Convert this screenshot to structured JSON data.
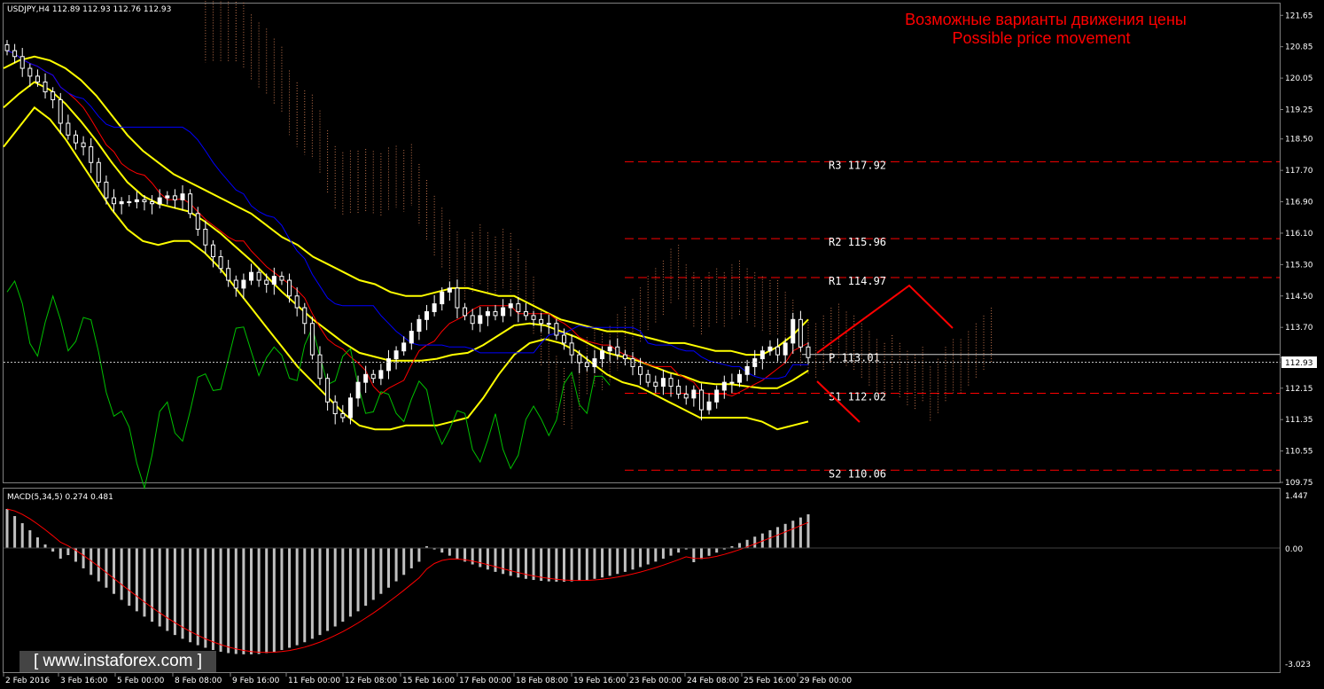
{
  "header": {
    "symbol_line": "USDJPY,H4  112.89 112.93 112.76 112.93",
    "macd_line": "MACD(5,34,5) 0.274 0.481"
  },
  "title_ru": "Возможные варианты движения цены",
  "title_en": "Possible price movement",
  "current_price_label": "112.93",
  "watermark": "[ www.instaforex.com ]",
  "colors": {
    "background": "#000000",
    "bull_candle": "#ffffff",
    "bear_candle": "#ffffff",
    "bollinger": "#ffff00",
    "tenkan": "#ff0000",
    "kijun": "#0000ff",
    "chikou": "#00c000",
    "cloud": "#ff9966",
    "pivot_levels": "#ff0000",
    "forecast": "#ff0000",
    "macd_hist": "#c0c0c0",
    "macd_signal": "#ff0000"
  },
  "chart_data": {
    "type": "candlestick",
    "symbol": "USDJPY",
    "timeframe": "H4",
    "ylim": [
      109.75,
      121.95
    ],
    "y_ticks": [
      "121.65",
      "120.85",
      "120.05",
      "119.25",
      "118.50",
      "117.70",
      "116.90",
      "116.10",
      "115.30",
      "114.50",
      "113.70",
      "112.93",
      "112.15",
      "111.35",
      "110.55",
      "109.75"
    ],
    "x_ticks": [
      "2 Feb 2016",
      "3 Feb 16:00",
      "5 Feb 00:00",
      "8 Feb 08:00",
      "9 Feb 16:00",
      "11 Feb 00:00",
      "12 Feb 08:00",
      "15 Feb 16:00",
      "17 Feb 00:00",
      "18 Feb 08:00",
      "19 Feb 16:00",
      "23 Feb 00:00",
      "24 Feb 08:00",
      "25 Feb 16:00",
      "29 Feb 00:00"
    ],
    "levels": [
      {
        "label": "R3 117.92",
        "value": 117.92
      },
      {
        "label": "R2 115.96",
        "value": 115.96
      },
      {
        "label": "R1 114.97",
        "value": 114.97
      },
      {
        "label": "P 113.01",
        "value": 113.01
      },
      {
        "label": "S1 112.02",
        "value": 112.02
      },
      {
        "label": "S2 110.06",
        "value": 110.06
      }
    ],
    "current_price": 112.93,
    "closes": [
      120.75,
      120.6,
      120.3,
      120.1,
      119.95,
      119.7,
      119.5,
      118.9,
      118.6,
      118.4,
      118.3,
      117.9,
      117.4,
      117.0,
      116.85,
      116.9,
      116.9,
      116.95,
      116.9,
      116.85,
      117.0,
      117.05,
      116.95,
      117.1,
      116.6,
      116.2,
      115.8,
      115.5,
      115.2,
      114.9,
      114.7,
      114.9,
      115.1,
      114.9,
      114.8,
      115.0,
      114.9,
      114.5,
      114.2,
      113.8,
      113.0,
      112.4,
      111.8,
      111.5,
      111.4,
      111.9,
      112.3,
      112.5,
      112.4,
      112.6,
      112.9,
      113.1,
      113.3,
      113.6,
      113.9,
      114.1,
      114.3,
      114.6,
      114.7,
      114.2,
      114.0,
      113.8,
      114.0,
      114.1,
      114.0,
      114.2,
      114.3,
      114.1,
      114.0,
      113.9,
      113.8,
      113.8,
      113.5,
      113.3,
      113.0,
      112.8,
      112.7,
      112.9,
      113.1,
      113.2,
      113.0,
      112.9,
      112.7,
      112.5,
      112.3,
      112.2,
      112.4,
      112.2,
      112.0,
      111.9,
      112.1,
      111.6,
      111.8,
      112.1,
      112.3,
      112.3,
      112.5,
      112.7,
      112.9,
      113.1,
      113.2,
      113.0,
      113.3,
      113.9,
      113.2,
      112.93
    ],
    "bollinger_upper": [
      120.3,
      120.5,
      120.6,
      120.5,
      120.3,
      120.0,
      119.6,
      119.1,
      118.6,
      118.2,
      117.9,
      117.6,
      117.4,
      117.2,
      117.0,
      116.8,
      116.6,
      116.3,
      116.0,
      115.8,
      115.5,
      115.3,
      115.1,
      114.9,
      114.8,
      114.6,
      114.5,
      114.5,
      114.6,
      114.7,
      114.7,
      114.6,
      114.5,
      114.5,
      114.3,
      114.1,
      113.9,
      113.8,
      113.7,
      113.6,
      113.6,
      113.5,
      113.4,
      113.3,
      113.3,
      113.2,
      113.1,
      113.1,
      113.0,
      113.0,
      113.2,
      113.5,
      113.9
    ],
    "bollinger_lower": [
      118.3,
      118.8,
      119.3,
      119.0,
      118.5,
      117.9,
      117.3,
      116.7,
      116.2,
      115.9,
      115.8,
      115.9,
      115.9,
      115.6,
      115.2,
      114.7,
      114.2,
      113.7,
      113.2,
      112.7,
      112.3,
      111.9,
      111.5,
      111.2,
      111.1,
      111.1,
      111.2,
      111.2,
      111.2,
      111.3,
      111.4,
      111.9,
      112.5,
      113.0,
      113.3,
      113.4,
      113.3,
      113.1,
      112.8,
      112.5,
      112.3,
      112.2,
      112.0,
      111.8,
      111.6,
      111.4,
      111.4,
      111.4,
      111.4,
      111.3,
      111.1,
      111.2,
      111.3
    ]
  }
}
